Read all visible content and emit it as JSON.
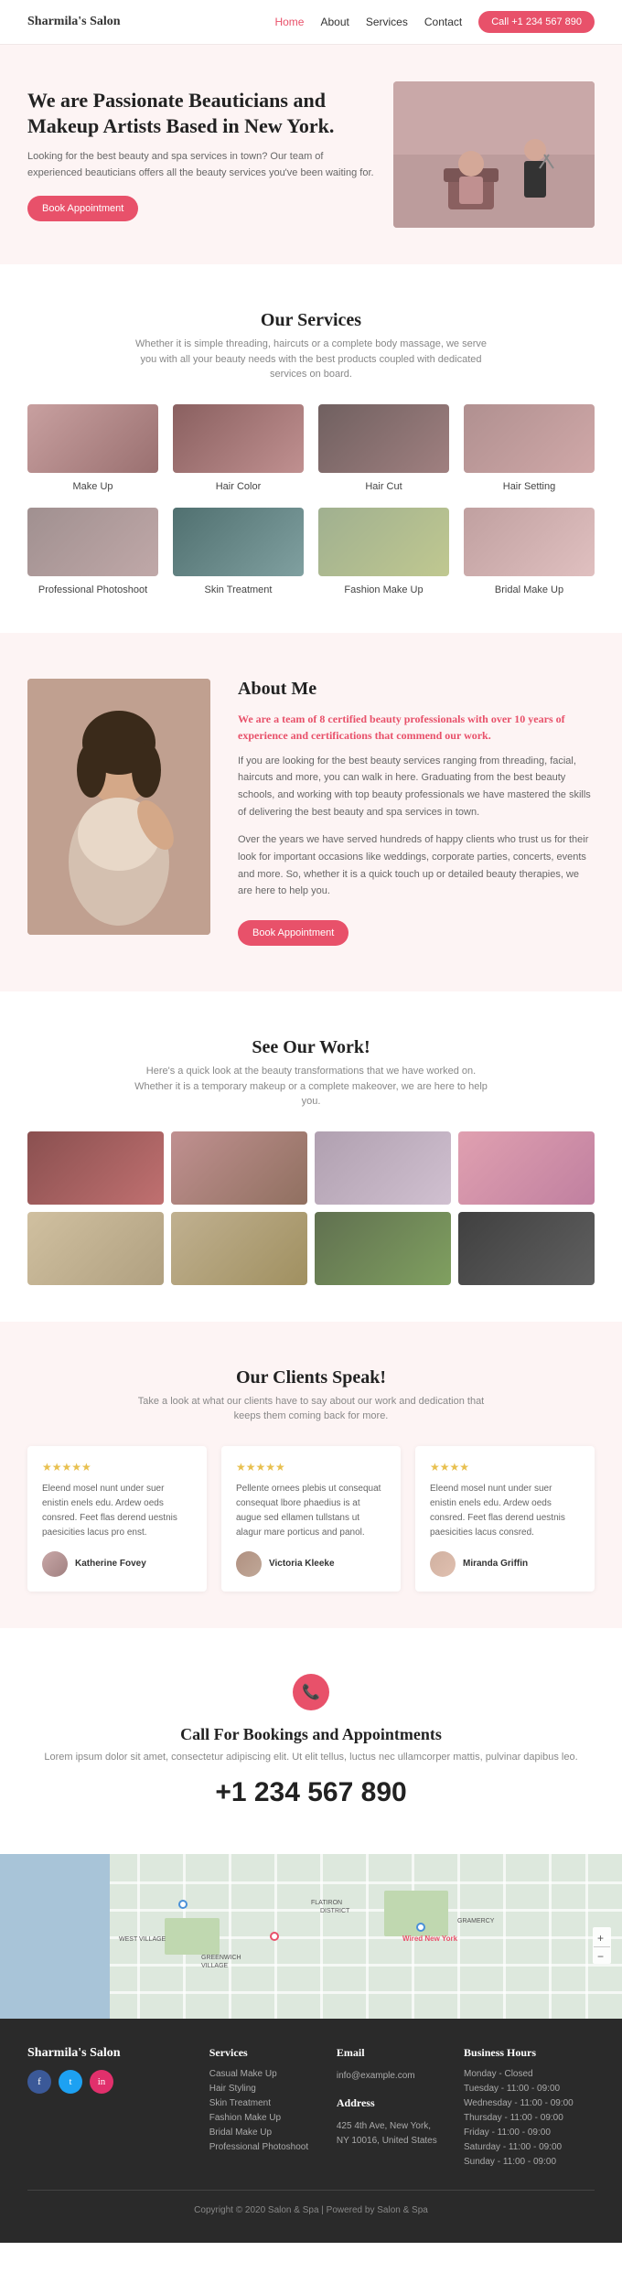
{
  "nav": {
    "logo": "Sharmila's Salon",
    "links": [
      "Home",
      "About",
      "Services",
      "Contact"
    ],
    "active_link": "Home",
    "cta_label": "Call +1 234 567 890"
  },
  "hero": {
    "heading": "We are Passionate Beauticians and Makeup Artists Based in New York.",
    "subtext": "Looking for the best beauty and spa services in town? Our team of experienced beauticians offers all the beauty services you've been waiting for.",
    "cta_label": "Book Appointment"
  },
  "services": {
    "heading": "Our Services",
    "subtext": "Whether it is simple threading, haircuts or a complete body massage, we serve you with all your beauty needs with the best products coupled with dedicated services on board.",
    "items": [
      {
        "label": "Make Up"
      },
      {
        "label": "Hair Color"
      },
      {
        "label": "Hair Cut"
      },
      {
        "label": "Hair Setting"
      },
      {
        "label": "Professional Photoshoot"
      },
      {
        "label": "Skin Treatment"
      },
      {
        "label": "Fashion Make Up"
      },
      {
        "label": "Bridal Make Up"
      }
    ]
  },
  "about": {
    "heading": "About Me",
    "highlight": "We are a team of 8 certified beauty professionals with over 10 years of experience and certifications that commend our work.",
    "text1": "If you are looking for the best beauty services ranging from threading, facial, haircuts and more, you can walk in here. Graduating from the best beauty schools, and working with top beauty professionals we have mastered the skills of delivering the best beauty and spa services in town.",
    "text2": "Over the years we have served hundreds of happy clients who trust us for their look for important occasions like weddings, corporate parties, concerts, events and more. So, whether it is a quick touch up or detailed beauty therapies, we are here to help you.",
    "cta_label": "Book Appointment"
  },
  "gallery": {
    "heading": "See Our Work!",
    "subtext": "Here's a quick look at the beauty transformations that we have worked on. Whether it is a temporary makeup or a complete makeover, we are here to help you."
  },
  "testimonials": {
    "heading": "Our Clients Speak!",
    "subtext": "Take a look at what our clients have to say about our work and dedication that keeps them coming back for more.",
    "items": [
      {
        "stars": "★★★★★",
        "text": "Eleend mosel nunt under suer enistin enels edu. Ardew oeds consred. Feet flas derend uestnis paesicities lacus pro enst.",
        "author": "Katherine Fovey"
      },
      {
        "stars": "★★★★★",
        "text": "Pellente ornees plebis ut consequat consequat lbore phaedius is at augue sed ellamen tullstans ut alagur mare porticus and panol.",
        "author": "Victoria Kleeke"
      },
      {
        "stars": "★★★★",
        "text": "Eleend mosel nunt under suer enistin enels edu. Ardew oeds consred. Feet flas derend uestnis paesicities lacus consred.",
        "author": "Miranda Griffin"
      }
    ]
  },
  "contact": {
    "heading": "Call For Bookings and Appointments",
    "subtext": "Lorem ipsum dolor sit amet, consectetur adipiscing elit. Ut elit tellus, luctus nec ullamcorper mattis, pulvinar dapibus leo.",
    "phone": "+1 234 567 890"
  },
  "footer": {
    "logo": "Sharmila's Salon",
    "social": [
      "f",
      "t",
      "i"
    ],
    "services_heading": "Services",
    "services_items": [
      "Casual Make Up",
      "Hair Styling",
      "Skin Treatment",
      "Fashion Make Up",
      "Bridal Make Up",
      "Professional Photoshoot"
    ],
    "email_heading": "Email",
    "email": "info@example.com",
    "address_heading": "Address",
    "address": "425 4th Ave, New York, NY 10016, United States",
    "hours_heading": "Business Hours",
    "hours": [
      "Monday - Closed",
      "Tuesday - 11:00 - 09:00",
      "Wednesday - 11:00 - 09:00",
      "Thursday - 11:00 - 09:00",
      "Friday - 11:00 - 09:00",
      "Saturday - 11:00 - 09:00",
      "Sunday - 11:00 - 09:00"
    ],
    "copyright": "Copyright © 2020 Salon & Spa | Powered by Salon & Spa"
  }
}
